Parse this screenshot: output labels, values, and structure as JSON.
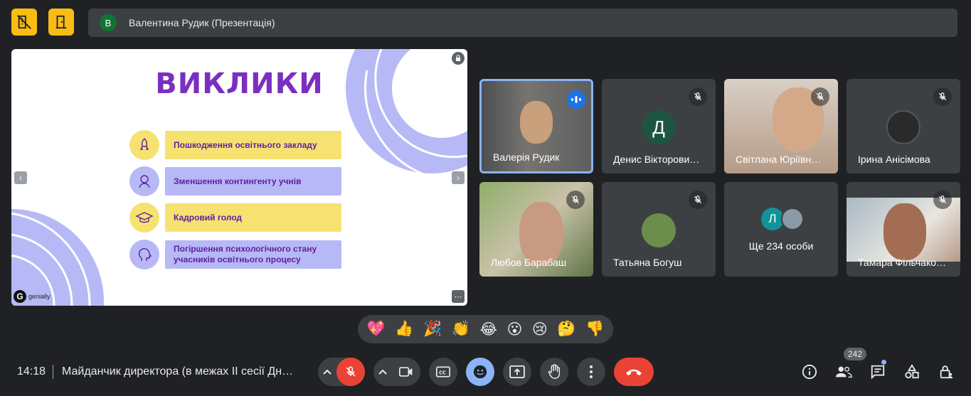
{
  "header": {
    "presenter_initial": "В",
    "presenter_label": "Валентина Рудик (Презентація)"
  },
  "slide": {
    "title": "ВИКЛИКИ",
    "items": [
      {
        "text": "Пошкодження освітнього закладу",
        "color": "#f6e271"
      },
      {
        "text": "Зменшення контингенту учнів",
        "color": "#b7b9f6"
      },
      {
        "text": "Кадровий голод",
        "color": "#f6e271"
      },
      {
        "text": "Погіршення психологічного стану учасників освітнього процесу",
        "color": "#b7b9f6"
      }
    ],
    "brand": "genially",
    "prev_label": "‹",
    "next_label": "›"
  },
  "participants": [
    {
      "name": "Валерія Рудик",
      "speaking": true
    },
    {
      "name": "Денис Вікторови…",
      "initial": "Д",
      "avatar_color": "#1e5540"
    },
    {
      "name": "Світлана Юріївн…"
    },
    {
      "name": "Ірина Анісімова"
    },
    {
      "name": "Любов Барабаш"
    },
    {
      "name": "Татьяна Богуш"
    },
    {
      "name": "Ще 234 особи",
      "initial": "Л"
    },
    {
      "name": "Тамара Фільчако…"
    }
  ],
  "reactions": [
    "💖",
    "👍",
    "🎉",
    "👏",
    "😂",
    "😮",
    "😢",
    "🤔",
    "👎"
  ],
  "bottom": {
    "time": "14:18",
    "meeting_title": "Майданчик директора (в межах ІІ сесії Дн…",
    "participants_count": "242"
  },
  "colors": {
    "accent": "#8ab4f8",
    "hangup": "#ea4335",
    "mic_off": "#ea4335",
    "emoji_active": "#8ab4f8"
  }
}
